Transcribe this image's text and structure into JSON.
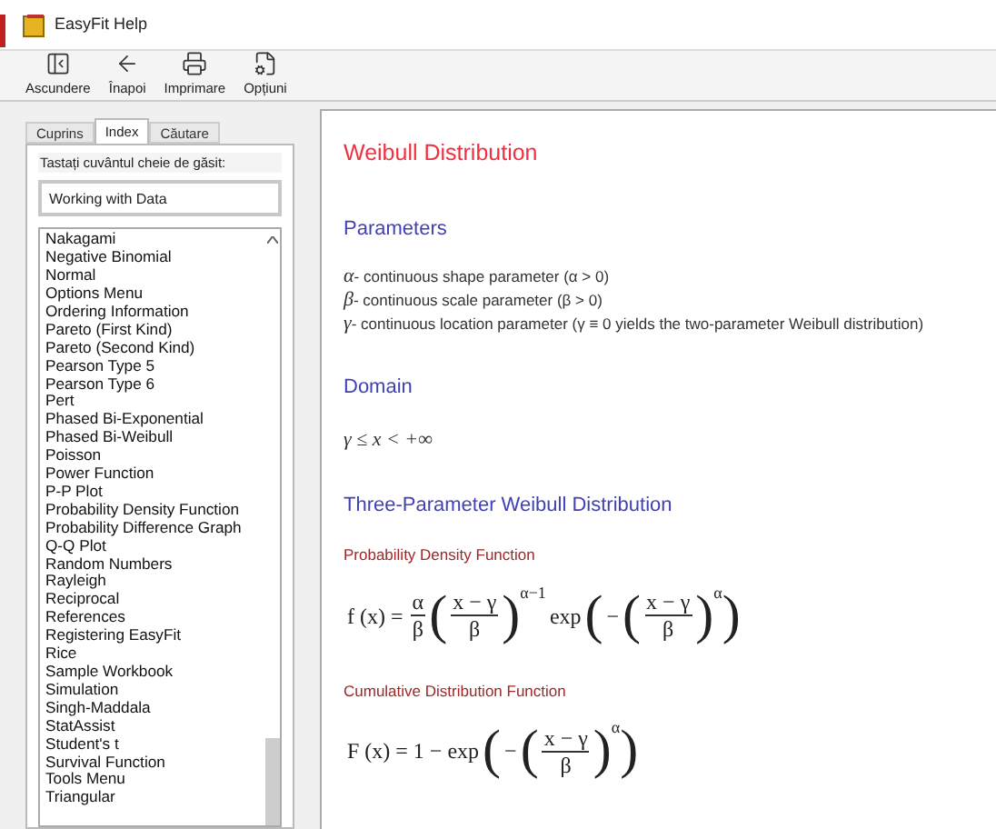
{
  "window": {
    "title": "EasyFit Help"
  },
  "toolbar": [
    {
      "label": "Ascundere",
      "kind": "hide"
    },
    {
      "label": "Înapoi",
      "kind": "back"
    },
    {
      "label": "Imprimare",
      "kind": "print"
    },
    {
      "label": "Opțiuni",
      "kind": "options"
    }
  ],
  "tabs": [
    {
      "label": "Cuprins",
      "selected": false
    },
    {
      "label": "Index",
      "selected": true
    },
    {
      "label": "Căutare",
      "selected": false
    }
  ],
  "index": {
    "prompt": "Tastați cuvântul cheie de găsit:",
    "value": "Working with Data",
    "items": [
      "Nakagami",
      "Negative Binomial",
      "Normal",
      "Options Menu",
      "Ordering Information",
      "Pareto (First Kind)",
      "Pareto (Second Kind)",
      "Pearson Type 5",
      "Pearson Type 6",
      "Pert",
      "Phased Bi-Exponential",
      "Phased Bi-Weibull",
      "Poisson",
      "Power Function",
      "P-P Plot",
      "Probability Density Function",
      "Probability Difference Graph",
      "Q-Q Plot",
      "Random Numbers",
      "Rayleigh",
      "Reciprocal",
      "References",
      "Registering EasyFit",
      "Rice",
      "Sample Workbook",
      "Simulation",
      "Singh-Maddala",
      "StatAssist",
      "Student's t",
      "Survival Function",
      "Tools Menu",
      "Triangular"
    ]
  },
  "content": {
    "title": "Weibull Distribution",
    "sections": [
      {
        "kind": "params",
        "heading": "Parameters",
        "params": [
          {
            "symbol": "α",
            "text": " - continuous shape parameter (α > 0)"
          },
          {
            "symbol": "β",
            "text": " - continuous scale parameter (β > 0)"
          },
          {
            "symbol": "γ",
            "text": " - continuous location parameter (γ ≡ 0  yields the two-parameter Weibull distribution)"
          }
        ]
      },
      {
        "kind": "domain",
        "heading": "Domain",
        "formula": "γ ≤ x < +∞"
      },
      {
        "kind": "formulas",
        "heading": "Three-Parameter Weibull Distribution",
        "items": [
          {
            "label": "Probability Density Function",
            "tokens": [
              {
                "kind": "text",
                "text": "f (x) ="
              },
              {
                "kind": "frac",
                "num": "α",
                "den": "β"
              },
              {
                "kind": "group",
                "open": "(",
                "close": ")",
                "sup": "α−1",
                "children": [
                  {
                    "kind": "frac",
                    "num": "x − γ",
                    "den": "β"
                  }
                ]
              },
              {
                "kind": "text",
                "text": "exp"
              },
              {
                "kind": "group",
                "open": "(",
                "close": ")",
                "children": [
                  {
                    "kind": "text",
                    "text": "−"
                  },
                  {
                    "kind": "group",
                    "open": "(",
                    "close": ")",
                    "sup": "α",
                    "children": [
                      {
                        "kind": "frac",
                        "num": "x − γ",
                        "den": "β"
                      }
                    ]
                  }
                ]
              }
            ]
          },
          {
            "label": "Cumulative Distribution Function",
            "tokens": [
              {
                "kind": "text",
                "text": "F (x) = 1 − exp"
              },
              {
                "kind": "group",
                "open": "(",
                "close": ")",
                "children": [
                  {
                    "kind": "text",
                    "text": "−"
                  },
                  {
                    "kind": "group",
                    "open": "(",
                    "close": ")",
                    "sup": "α",
                    "children": [
                      {
                        "kind": "frac",
                        "num": "x − γ",
                        "den": "β"
                      }
                    ]
                  }
                ]
              }
            ]
          }
        ]
      }
    ]
  }
}
